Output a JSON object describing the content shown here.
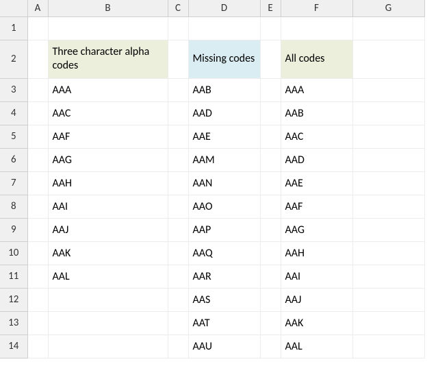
{
  "columns": [
    "A",
    "B",
    "C",
    "D",
    "E",
    "F",
    "G"
  ],
  "rows": [
    "1",
    "2",
    "3",
    "4",
    "5",
    "6",
    "7",
    "8",
    "9",
    "10",
    "11",
    "12",
    "13",
    "14"
  ],
  "headers": {
    "three_char": "Three character alpha codes",
    "missing": "Missing codes",
    "all": "All codes"
  },
  "three_char_codes": [
    "AAA",
    "AAC",
    "AAF",
    "AAG",
    "AAH",
    "AAI",
    "AAJ",
    "AAK",
    "AAL"
  ],
  "missing_codes": [
    "AAB",
    "AAD",
    "AAE",
    "AAM",
    "AAN",
    "AAO",
    "AAP",
    "AAQ",
    "AAR",
    "AAS",
    "AAT",
    "AAU"
  ],
  "all_codes": [
    "AAA",
    "AAB",
    "AAC",
    "AAD",
    "AAE",
    "AAF",
    "AAG",
    "AAH",
    "AAI",
    "AAJ",
    "AAK",
    "AAL"
  ]
}
